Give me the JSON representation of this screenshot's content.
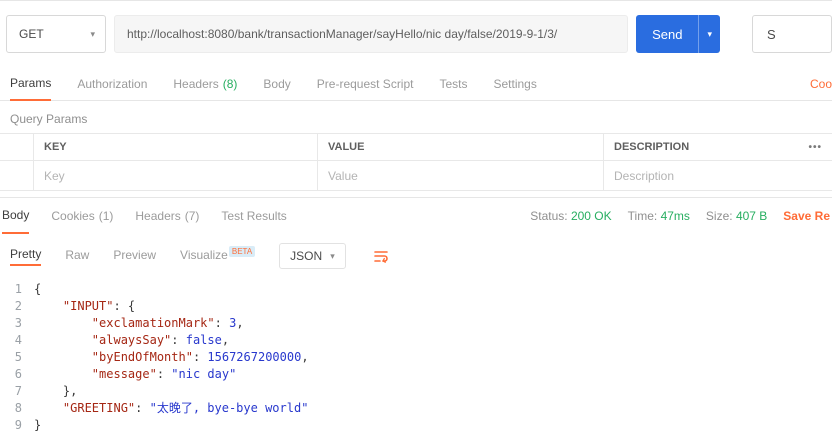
{
  "request": {
    "method": "GET",
    "url": "http://localhost:8080/bank/transactionManager/sayHello/nic day/false/2019-9-1/3/",
    "send_label": "Send",
    "save_label": "S"
  },
  "request_tabs": {
    "params": {
      "label": "Params"
    },
    "authorization": {
      "label": "Authorization"
    },
    "headers": {
      "label": "Headers",
      "count": "(8)"
    },
    "body": {
      "label": "Body"
    },
    "prerequest": {
      "label": "Pre-request Script"
    },
    "tests": {
      "label": "Tests"
    },
    "settings": {
      "label": "Settings"
    },
    "cookies_link": "Coo"
  },
  "query_params": {
    "section_title": "Query Params",
    "columns": {
      "key": "KEY",
      "value": "VALUE",
      "description": "DESCRIPTION"
    },
    "menu": "•••",
    "row_placeholders": {
      "key": "Key",
      "value": "Value",
      "description": "Description"
    }
  },
  "response": {
    "tabs": {
      "body": {
        "label": "Body"
      },
      "cookies": {
        "label": "Cookies",
        "count": "(1)"
      },
      "headers": {
        "label": "Headers",
        "count": "(7)"
      },
      "test_results": {
        "label": "Test Results"
      }
    },
    "status": {
      "label": "Status:",
      "value": "200 OK"
    },
    "time": {
      "label": "Time:",
      "value": "47ms"
    },
    "size": {
      "label": "Size:",
      "value": "407 B"
    },
    "save_response_label": "Save Re"
  },
  "viewer": {
    "tabs": {
      "pretty": "Pretty",
      "raw": "Raw",
      "preview": "Preview",
      "visualize": "Visualize",
      "beta": "BETA"
    },
    "format": "JSON"
  },
  "colors": {
    "accent_orange": "#ff6c37",
    "status_green": "#27ae60",
    "send_blue": "#2a6de0",
    "json_key_color": "#a52714",
    "json_value_color": "#2838cd"
  },
  "response_body": {
    "lines": [
      {
        "num": "1",
        "tokens": [
          {
            "c": "p",
            "t": "{"
          }
        ]
      },
      {
        "num": "2",
        "tokens": [
          {
            "c": "p",
            "t": "    "
          },
          {
            "c": "k",
            "t": "\"INPUT\""
          },
          {
            "c": "p",
            "t": ": {"
          }
        ]
      },
      {
        "num": "3",
        "tokens": [
          {
            "c": "p",
            "t": "        "
          },
          {
            "c": "k",
            "t": "\"exclamationMark\""
          },
          {
            "c": "p",
            "t": ": "
          },
          {
            "c": "v",
            "t": "3"
          },
          {
            "c": "p",
            "t": ","
          }
        ]
      },
      {
        "num": "4",
        "tokens": [
          {
            "c": "p",
            "t": "        "
          },
          {
            "c": "k",
            "t": "\"alwaysSay\""
          },
          {
            "c": "p",
            "t": ": "
          },
          {
            "c": "v",
            "t": "false"
          },
          {
            "c": "p",
            "t": ","
          }
        ]
      },
      {
        "num": "5",
        "tokens": [
          {
            "c": "p",
            "t": "        "
          },
          {
            "c": "k",
            "t": "\"byEndOfMonth\""
          },
          {
            "c": "p",
            "t": ": "
          },
          {
            "c": "v",
            "t": "1567267200000"
          },
          {
            "c": "p",
            "t": ","
          }
        ]
      },
      {
        "num": "6",
        "tokens": [
          {
            "c": "p",
            "t": "        "
          },
          {
            "c": "k",
            "t": "\"message\""
          },
          {
            "c": "p",
            "t": ": "
          },
          {
            "c": "v",
            "t": "\"nic day\""
          }
        ]
      },
      {
        "num": "7",
        "tokens": [
          {
            "c": "p",
            "t": "    },"
          }
        ]
      },
      {
        "num": "8",
        "tokens": [
          {
            "c": "p",
            "t": "    "
          },
          {
            "c": "k",
            "t": "\"GREETING\""
          },
          {
            "c": "p",
            "t": ": "
          },
          {
            "c": "v",
            "t": "\"太晚了, bye-bye world\""
          }
        ]
      },
      {
        "num": "9",
        "tokens": [
          {
            "c": "p",
            "t": "}"
          }
        ]
      }
    ]
  }
}
